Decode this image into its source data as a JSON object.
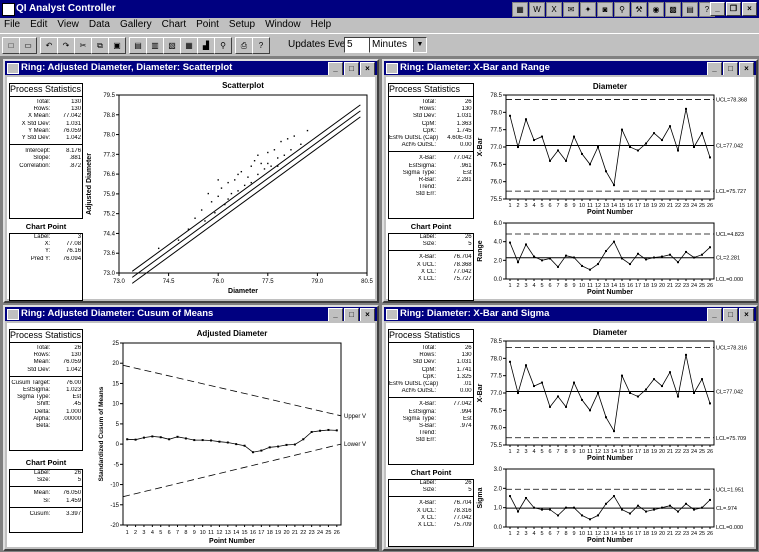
{
  "app": {
    "title": "QI Analyst Controller"
  },
  "menu": [
    "File",
    "Edit",
    "View",
    "Data",
    "Gallery",
    "Chart",
    "Point",
    "Setup",
    "Window",
    "Help"
  ],
  "toolbar": {
    "updates_label": "Updates Every:",
    "updates_value": "5",
    "unit_value": "Minutes"
  },
  "windows": {
    "scatter": {
      "title": "Ring: Adjusted Diameter, Diameter: Scatterplot",
      "stats_title": "Process Statistics",
      "stats": [
        [
          "Total:",
          "130"
        ],
        [
          "Rows:",
          "130"
        ],
        [
          "X Mean:",
          "77.042"
        ],
        [
          "X Std Dev:",
          "1.031"
        ],
        [
          "Y Mean:",
          "76.059"
        ],
        [
          "Y Std Dev:",
          "1.042"
        ],
        [
          "",
          ""
        ],
        [
          "Intercept:",
          "8.176"
        ],
        [
          "Slope:",
          ".881"
        ],
        [
          "Correlation:",
          ".872"
        ]
      ],
      "point_title": "Chart Point",
      "point": [
        [
          "Label:",
          "3"
        ],
        [
          "X:",
          "77.08"
        ],
        [
          "Y:",
          "76.16"
        ],
        [
          "Pred Y:",
          "76.094"
        ]
      ]
    },
    "xbar_range": {
      "title": "Ring: Diameter: X-Bar and Range",
      "stats_title": "Process Statistics",
      "stats": [
        [
          "Total:",
          "26"
        ],
        [
          "Rows:",
          "130"
        ],
        [
          "Std Dev:",
          "1.031"
        ],
        [
          "CpM:",
          "1.363"
        ],
        [
          "CpK:",
          "1.745"
        ],
        [
          "Est% OutSL (Cap):",
          "4.60E-03"
        ],
        [
          "Act% OutSL:",
          "0.00"
        ],
        [
          "",
          ""
        ],
        [
          "X-Bar:",
          "77.042"
        ],
        [
          "EstSigma:",
          ".961"
        ],
        [
          "Sigma Type:",
          "Est"
        ],
        [
          "R-Bar:",
          "2.281"
        ],
        [
          "Trend:",
          ""
        ],
        [
          "Std Err:",
          ""
        ]
      ],
      "point_title": "Chart Point",
      "point": [
        [
          "Label:",
          "26"
        ],
        [
          "Size:",
          "5"
        ],
        [
          "",
          ""
        ],
        [
          "X-Bar:",
          "76.704"
        ],
        [
          "X UCL:",
          "78.368"
        ],
        [
          "X CL:",
          "77.042"
        ],
        [
          "X LCL:",
          "75.727"
        ]
      ]
    },
    "cusum": {
      "title": "Ring: Adjusted Diameter: Cusum of Means",
      "stats_title": "Process Statistics",
      "stats": [
        [
          "Total:",
          "26"
        ],
        [
          "Rows:",
          "130"
        ],
        [
          "Mean:",
          "76.059"
        ],
        [
          "Std Dev:",
          "1.042"
        ],
        [
          "",
          ""
        ],
        [
          "Cusum Target:",
          "76.00"
        ],
        [
          "EstSigma:",
          "1.023"
        ],
        [
          "Sigma Type:",
          "Est"
        ],
        [
          "Shift:",
          ".45"
        ],
        [
          "Delta:",
          "1.000"
        ],
        [
          "Alpha:",
          ".00000"
        ],
        [
          "Beta:",
          ""
        ]
      ],
      "point_title": "Chart Point",
      "point": [
        [
          "Label:",
          "26"
        ],
        [
          "Size:",
          "5"
        ],
        [
          "",
          ""
        ],
        [
          "Mean:",
          "76.050"
        ],
        [
          "Si:",
          "1.459"
        ],
        [
          "",
          ""
        ],
        [
          "Cusum:",
          "3.397"
        ]
      ]
    },
    "xbar_sigma": {
      "title": "Ring: Diameter: X-Bar and Sigma",
      "stats_title": "Process Statistics",
      "stats": [
        [
          "Total:",
          "26"
        ],
        [
          "Rows:",
          "130"
        ],
        [
          "Std Dev:",
          "1.031"
        ],
        [
          "CpM:",
          "1.741"
        ],
        [
          "CpK:",
          "1.325"
        ],
        [
          "Est% OutSL (Cap):",
          ".01"
        ],
        [
          "Act% OutSL:",
          "0.00"
        ],
        [
          "",
          ""
        ],
        [
          "X-Bar:",
          "77.042"
        ],
        [
          "EstSigma:",
          ".994"
        ],
        [
          "Sigma Type:",
          "Est"
        ],
        [
          "S-Bar:",
          ".974"
        ],
        [
          "Trend:",
          ""
        ],
        [
          "Std Err:",
          ""
        ]
      ],
      "point_title": "Chart Point",
      "point": [
        [
          "Label:",
          "26"
        ],
        [
          "Size:",
          "5"
        ],
        [
          "",
          ""
        ],
        [
          "X-Bar:",
          "76.704"
        ],
        [
          "X UCL:",
          "78.316"
        ],
        [
          "X CL:",
          "77.042"
        ],
        [
          "X LCL:",
          "75.709"
        ]
      ]
    }
  },
  "chart_data": [
    {
      "type": "scatter",
      "title": "Scatterplot",
      "xlabel": "Diameter",
      "ylabel": "Adjusted Diameter",
      "xlim": [
        73.0,
        80.5
      ],
      "ylim": [
        73.0,
        79.5
      ],
      "xticks": [
        "73.0",
        "74.5",
        "76.0",
        "77.5",
        "79.0",
        "80.5"
      ],
      "yticks": [
        "73.0",
        "73.6",
        "74.4",
        "75.2",
        "75.9",
        "76.6",
        "77.3",
        "78.0",
        "78.8",
        "79.5"
      ],
      "fit": {
        "intercept": 8.176,
        "slope": 0.881
      },
      "band_offset": 0.22,
      "points": [
        [
          74.2,
          73.9
        ],
        [
          74.8,
          74.2
        ],
        [
          75.1,
          74.6
        ],
        [
          75.3,
          75.0
        ],
        [
          75.5,
          75.3
        ],
        [
          75.6,
          74.9
        ],
        [
          75.8,
          75.6
        ],
        [
          75.9,
          75.2
        ],
        [
          76.0,
          75.8
        ],
        [
          76.1,
          76.1
        ],
        [
          76.2,
          75.5
        ],
        [
          76.3,
          76.3
        ],
        [
          76.4,
          75.9
        ],
        [
          76.5,
          76.4
        ],
        [
          76.6,
          76.0
        ],
        [
          76.7,
          76.7
        ],
        [
          76.8,
          76.2
        ],
        [
          76.9,
          76.5
        ],
        [
          77.0,
          76.9
        ],
        [
          77.0,
          76.3
        ],
        [
          77.1,
          77.1
        ],
        [
          77.2,
          76.6
        ],
        [
          77.3,
          77.0
        ],
        [
          77.4,
          76.8
        ],
        [
          77.5,
          77.4
        ],
        [
          77.6,
          76.9
        ],
        [
          77.7,
          77.5
        ],
        [
          77.8,
          77.2
        ],
        [
          77.9,
          77.8
        ],
        [
          78.0,
          77.3
        ],
        [
          78.1,
          77.9
        ],
        [
          78.2,
          77.5
        ],
        [
          78.3,
          78.0
        ],
        [
          78.5,
          77.7
        ],
        [
          78.7,
          78.2
        ],
        [
          76.0,
          76.4
        ],
        [
          76.6,
          76.6
        ],
        [
          77.2,
          77.3
        ],
        [
          75.7,
          75.9
        ],
        [
          77.8,
          76.9
        ],
        [
          76.3,
          75.7
        ],
        [
          77.5,
          77.0
        ]
      ]
    },
    {
      "type": "line",
      "title": "Diameter",
      "ylabel": "X-Bar",
      "xlabel": "Point Number",
      "ylim": [
        75.5,
        78.5
      ],
      "yticks": [
        "75.5",
        "76.0",
        "76.5",
        "77.0",
        "77.5",
        "78.0",
        "78.5"
      ],
      "x": [
        1,
        2,
        3,
        4,
        5,
        6,
        7,
        8,
        9,
        10,
        11,
        12,
        13,
        14,
        15,
        16,
        17,
        18,
        19,
        20,
        21,
        22,
        23,
        24,
        25,
        26
      ],
      "values": [
        77.9,
        77.0,
        77.8,
        77.2,
        77.3,
        76.6,
        76.9,
        76.6,
        77.3,
        76.8,
        76.5,
        77.0,
        76.3,
        75.9,
        77.5,
        77.0,
        76.9,
        77.1,
        77.4,
        77.2,
        77.6,
        76.9,
        78.1,
        77.0,
        77.4,
        76.7
      ],
      "limits": {
        "ucl": 78.368,
        "cl": 77.042,
        "lcl": 75.727
      },
      "limit_labels": {
        "ucl": "UCL=78.368",
        "cl": "CL=77.042",
        "lcl": "LCL=75.727"
      }
    },
    {
      "type": "line",
      "ylabel": "Range",
      "xlabel": "Point Number",
      "ylim": [
        0.0,
        6.0
      ],
      "yticks": [
        "0.0",
        "2.0",
        "4.0",
        "6.0"
      ],
      "x": [
        1,
        2,
        3,
        4,
        5,
        6,
        7,
        8,
        9,
        10,
        11,
        12,
        13,
        14,
        15,
        16,
        17,
        18,
        19,
        20,
        21,
        22,
        23,
        24,
        25,
        26
      ],
      "values": [
        3.9,
        1.8,
        3.7,
        2.4,
        2.0,
        2.2,
        1.3,
        2.5,
        2.3,
        1.4,
        1.0,
        1.6,
        3.0,
        4.0,
        2.2,
        1.6,
        2.7,
        2.1,
        2.3,
        2.4,
        2.6,
        1.8,
        2.9,
        2.3,
        2.6,
        3.4
      ],
      "limits": {
        "ucl": 4.823,
        "cl": 2.281,
        "lcl": 0.0
      },
      "limit_labels": {
        "ucl": "UCL=4.823",
        "cl": "CL=2.281",
        "lcl": "LCL=0.000"
      }
    },
    {
      "type": "line",
      "title": "Adjusted Diameter",
      "ylabel": "Standardized Cusum of Means",
      "xlabel": "Point Number",
      "ylim": [
        -20,
        25
      ],
      "yticks": [
        "-20",
        "-15",
        "-10",
        "-5",
        "0",
        "5",
        "10",
        "15",
        "20",
        "25"
      ],
      "x": [
        1,
        2,
        3,
        4,
        5,
        6,
        7,
        8,
        9,
        10,
        11,
        12,
        13,
        14,
        15,
        16,
        17,
        18,
        19,
        20,
        21,
        22,
        23,
        24,
        25,
        26
      ],
      "values": [
        1.2,
        1.1,
        1.6,
        1.9,
        1.7,
        1.2,
        1.8,
        1.4,
        1.0,
        1.0,
        0.9,
        0.6,
        0.4,
        0.0,
        -0.4,
        -2.0,
        -1.6,
        -0.8,
        -0.6,
        -0.2,
        -0.1,
        1.2,
        3.0,
        3.3,
        3.5,
        3.4
      ],
      "v_mask": {
        "upper_start": 19.5,
        "upper_end": 7.0,
        "lower_start": -13.0,
        "lower_end": 0.0
      },
      "mask_labels": {
        "upper": "Upper V",
        "lower": "Lower V"
      }
    },
    {
      "type": "line",
      "title": "Diameter",
      "ylabel": "X-Bar",
      "xlabel": "Point Number",
      "ylim": [
        75.5,
        78.5
      ],
      "yticks": [
        "75.5",
        "76.0",
        "76.5",
        "77.0",
        "77.5",
        "78.0",
        "78.5"
      ],
      "x": [
        1,
        2,
        3,
        4,
        5,
        6,
        7,
        8,
        9,
        10,
        11,
        12,
        13,
        14,
        15,
        16,
        17,
        18,
        19,
        20,
        21,
        22,
        23,
        24,
        25,
        26
      ],
      "values": [
        77.9,
        77.0,
        77.8,
        77.2,
        77.3,
        76.6,
        76.9,
        76.6,
        77.3,
        76.8,
        76.5,
        77.0,
        76.3,
        75.9,
        77.5,
        77.0,
        76.9,
        77.1,
        77.4,
        77.2,
        77.6,
        76.9,
        78.1,
        77.0,
        77.4,
        76.7
      ],
      "limits": {
        "ucl": 78.316,
        "cl": 77.042,
        "lcl": 75.709
      },
      "limit_labels": {
        "ucl": "UCL=78.316",
        "cl": "CL=77.042",
        "lcl": "LCL=75.709"
      }
    },
    {
      "type": "line",
      "ylabel": "Sigma",
      "xlabel": "Point Number",
      "ylim": [
        0.0,
        3.0
      ],
      "yticks": [
        "0.0",
        "1.0",
        "2.0",
        "3.0"
      ],
      "x": [
        1,
        2,
        3,
        4,
        5,
        6,
        7,
        8,
        9,
        10,
        11,
        12,
        13,
        14,
        15,
        16,
        17,
        18,
        19,
        20,
        21,
        22,
        23,
        24,
        25,
        26
      ],
      "values": [
        1.6,
        0.8,
        1.5,
        1.0,
        0.9,
        0.9,
        0.6,
        1.0,
        1.0,
        0.6,
        0.4,
        0.6,
        1.2,
        1.6,
        0.9,
        0.7,
        1.1,
        0.8,
        0.9,
        1.0,
        1.1,
        0.8,
        1.2,
        0.9,
        1.0,
        1.4
      ],
      "limits": {
        "ucl": 1.951,
        "cl": 0.974,
        "lcl": 0.0
      },
      "limit_labels": {
        "ucl": "UCL=1.951",
        "cl": "CL=.974",
        "lcl": "LCL=0.000"
      }
    }
  ]
}
